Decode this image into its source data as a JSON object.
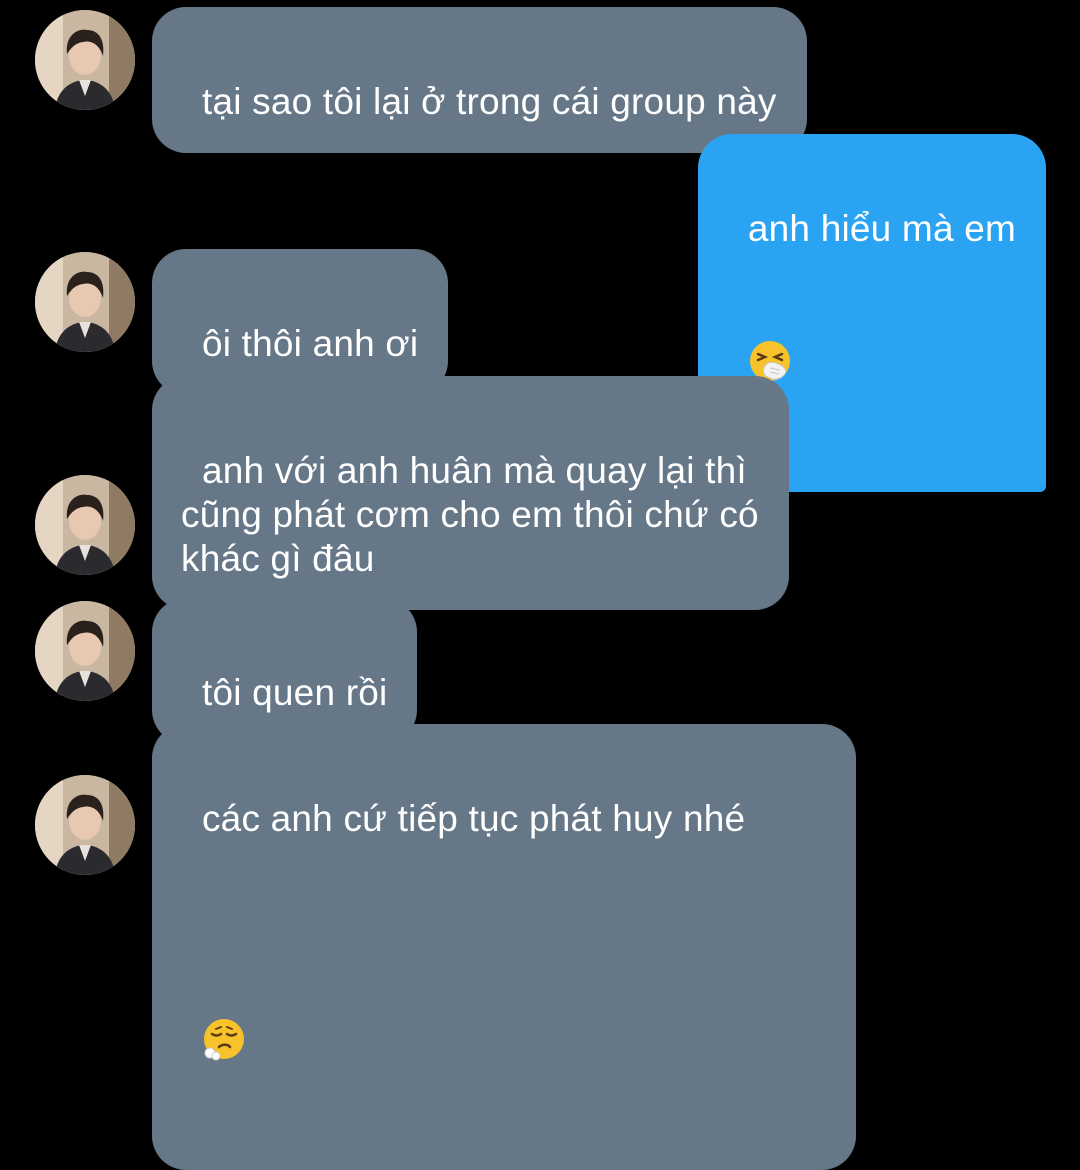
{
  "messages": [
    {
      "sender": "other",
      "text": "tại sao tôi lại ở trong cái group này"
    },
    {
      "sender": "me",
      "text": "anh hiểu mà em",
      "emoji": "sneezing-face"
    },
    {
      "sender": "other",
      "text": "ôi thôi anh ơi"
    },
    {
      "sender": "other",
      "text": "anh với anh huân mà quay lại thì\ncũng phát cơm cho em thôi chứ có\nkhác gì đâu"
    },
    {
      "sender": "other",
      "text": "tôi quen rồi"
    },
    {
      "sender": "other",
      "text": "các anh cứ tiếp tục phát huy nhé",
      "emoji": "face-exhaling"
    }
  ],
  "colors": {
    "background": "#000000",
    "incoming_bubble": "#667788",
    "outgoing_bubble": "#2aa3f2",
    "text": "#ffffff"
  }
}
